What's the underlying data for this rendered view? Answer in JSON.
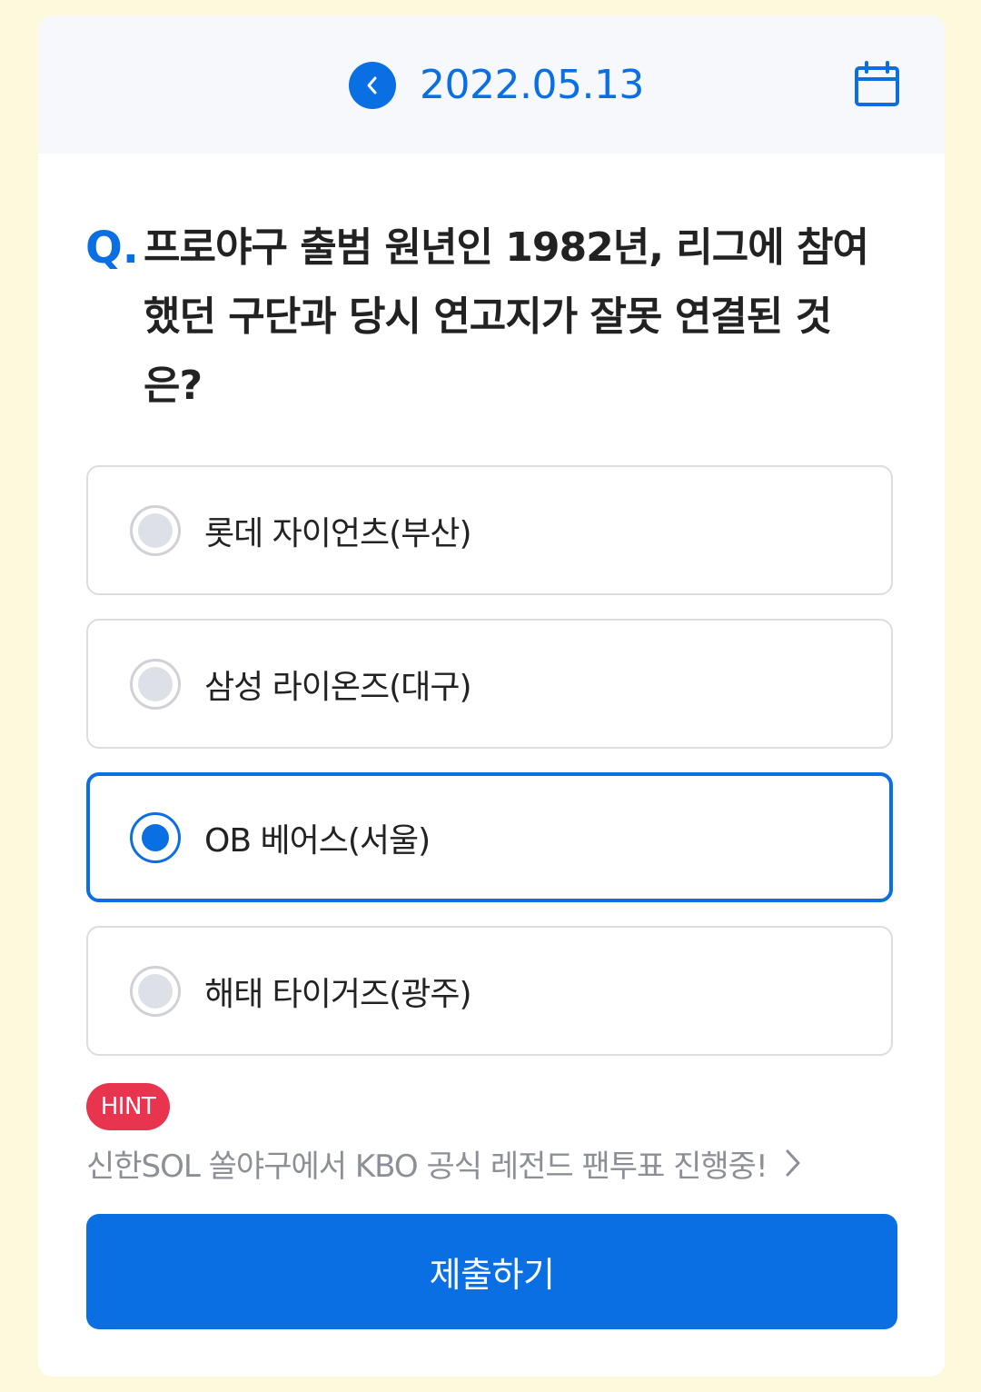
{
  "header": {
    "date": "2022.05.13",
    "prev_icon": "chevron-left-icon",
    "calendar_icon": "calendar-icon"
  },
  "quiz": {
    "q_mark": "Q.",
    "question": "프로야구 출범 원년인 1982년, 리그에 참여했던 구단과 당시 연고지가 잘못 연결된 것은?",
    "options": [
      {
        "label": "롯데 자이언츠(부산)",
        "selected": false
      },
      {
        "label": "삼성 라이온즈(대구)",
        "selected": false
      },
      {
        "label": "OB 베어스(서울)",
        "selected": true
      },
      {
        "label": "해태 타이거즈(광주)",
        "selected": false
      }
    ]
  },
  "hint": {
    "badge": "HINT",
    "text": "신한SOL 쏠야구에서 KBO 공식 레전드 팬투표 진행중!",
    "chevron_icon": "chevron-right-icon"
  },
  "submit_label": "제출하기",
  "colors": {
    "accent": "#0a6fe3",
    "hint_badge": "#e8344e",
    "background": "#fcf9dd"
  }
}
